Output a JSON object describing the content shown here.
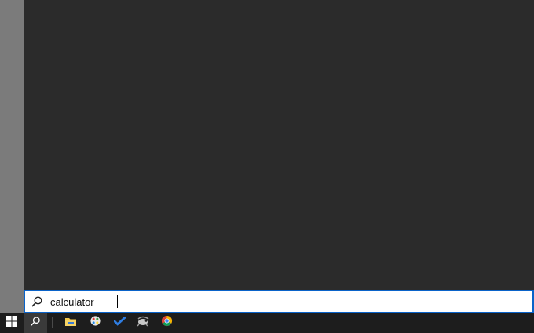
{
  "search": {
    "query": "calculator",
    "icon": "search-icon"
  },
  "taskbar": {
    "items": [
      {
        "name": "start-button",
        "icon": "windows-icon"
      },
      {
        "name": "search-button",
        "icon": "search-icon"
      },
      {
        "name": "file-explorer",
        "icon": "folder-icon"
      },
      {
        "name": "paint-app",
        "icon": "palette-icon"
      },
      {
        "name": "todo-app",
        "icon": "checkmark-icon"
      },
      {
        "name": "chameleon-app",
        "icon": "chameleon-icon"
      },
      {
        "name": "chrome-browser",
        "icon": "chrome-icon"
      }
    ]
  },
  "colors": {
    "panel": "#2b2b2b",
    "taskbar": "#1d1d1d",
    "accent": "#0a63c9",
    "left_strip": "#7b7b7b"
  }
}
